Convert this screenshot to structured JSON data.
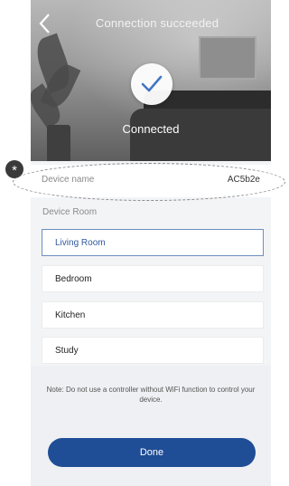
{
  "header": {
    "title": "Connection succeeded",
    "back_icon": "chevron-left-icon",
    "status_icon": "checkmark-icon",
    "status_text": "Connected"
  },
  "device": {
    "name_label": "Device name",
    "name_value": "AC5b2e"
  },
  "annotation": {
    "badge": "*"
  },
  "room": {
    "label": "Device Room",
    "selected": "Living Room",
    "options": [
      "Living Room",
      "Bedroom",
      "Kitchen",
      "Study"
    ]
  },
  "note": "Note: Do not use a controller without WiFi function to control your device.",
  "done_label": "Done",
  "colors": {
    "accent": "#1f4d96",
    "selected_border": "#6c8fc0"
  }
}
